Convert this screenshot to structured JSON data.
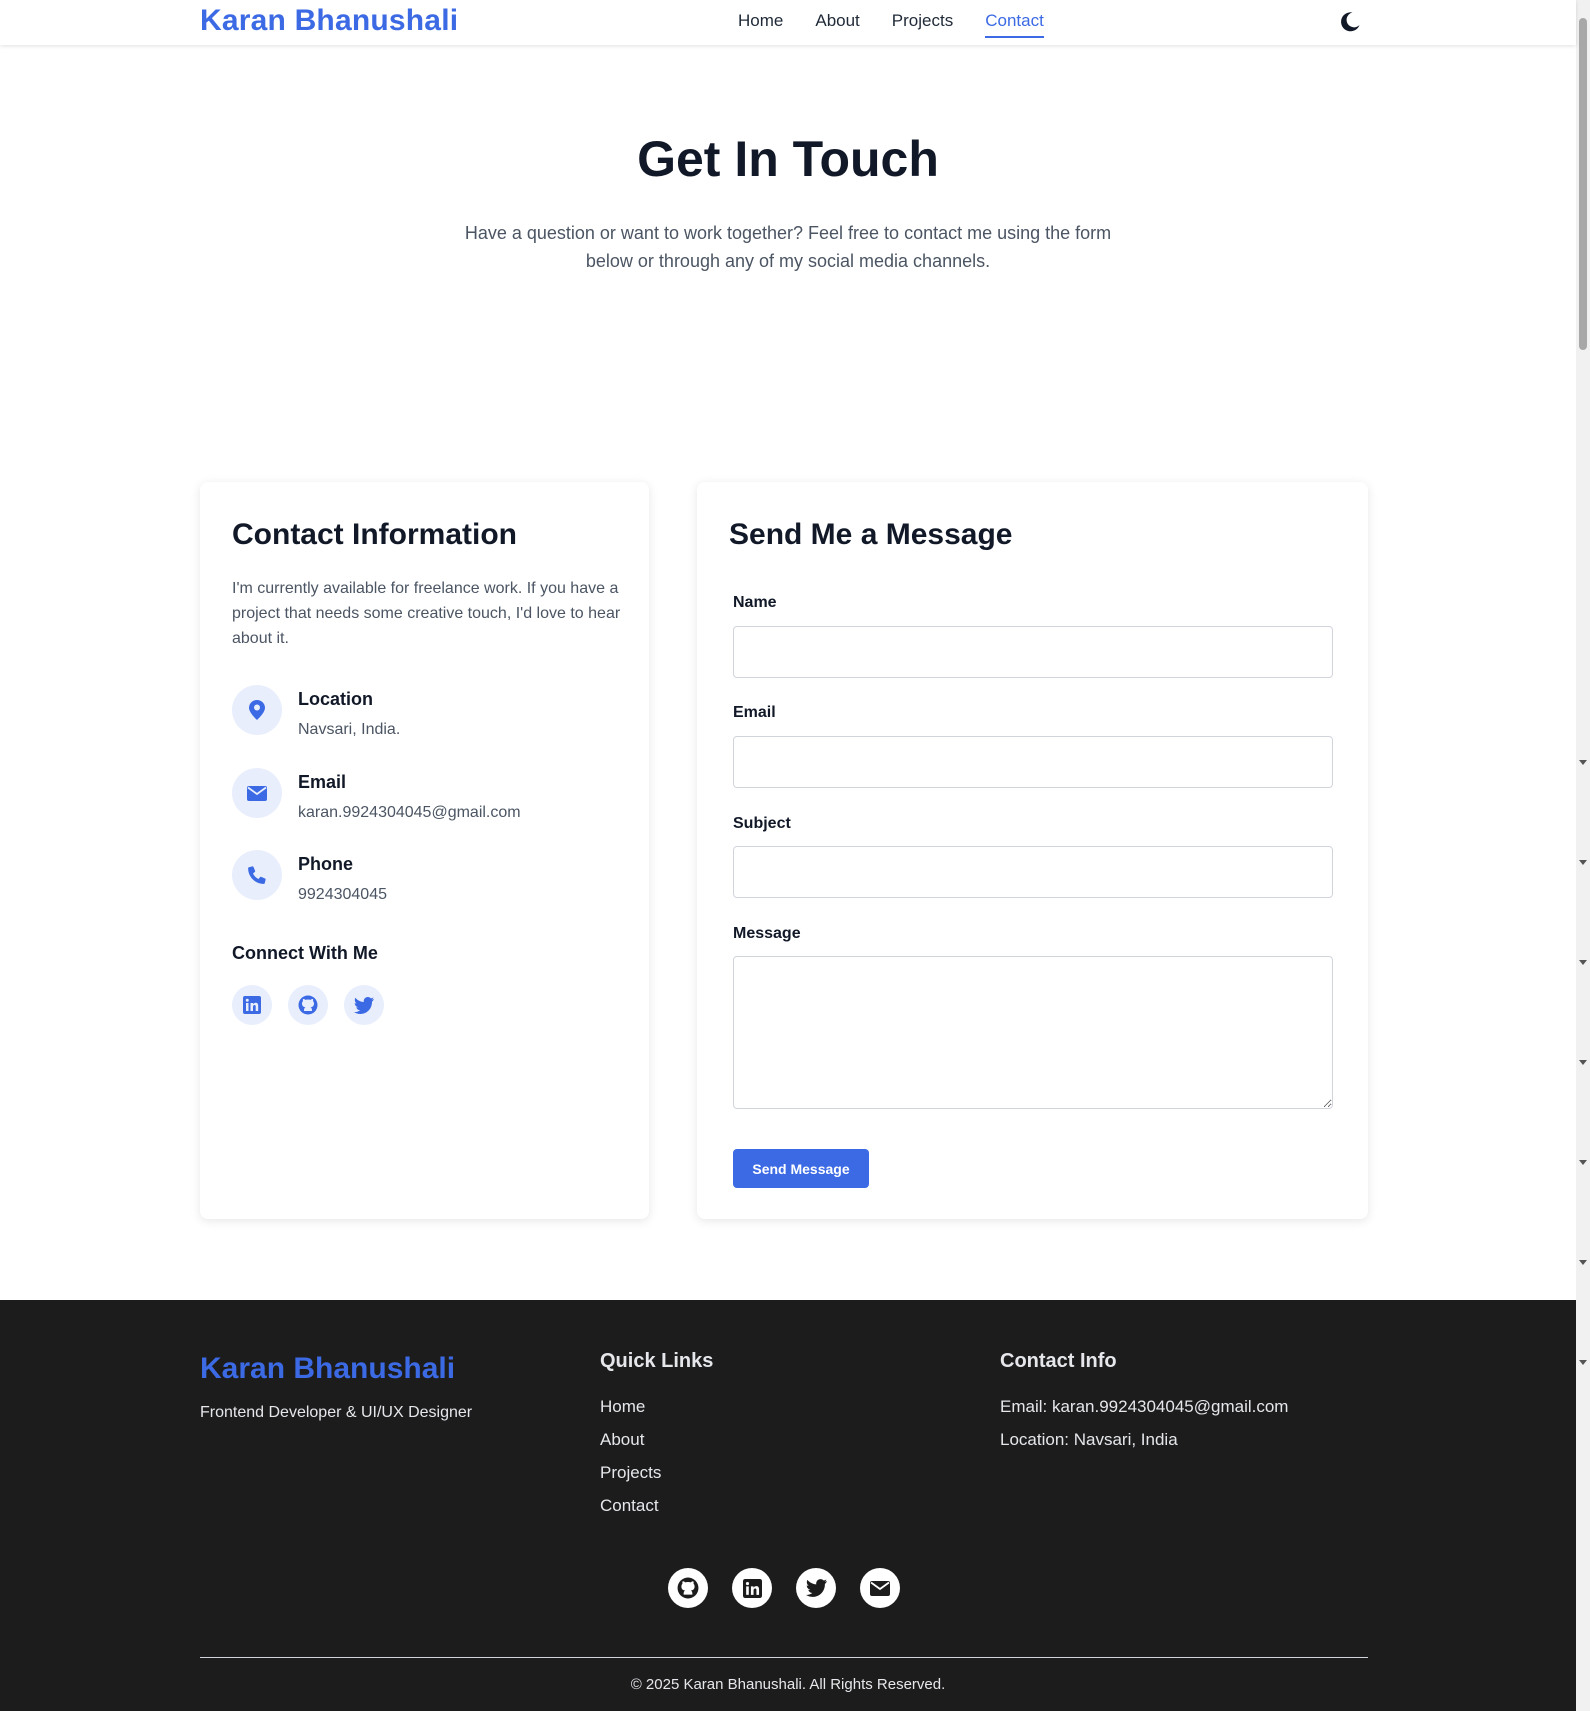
{
  "header": {
    "brand": "Karan Bhanushali",
    "nav": [
      {
        "label": "Home",
        "active": false
      },
      {
        "label": "About",
        "active": false
      },
      {
        "label": "Projects",
        "active": false
      },
      {
        "label": "Contact",
        "active": true
      }
    ],
    "theme_icon": "moon-icon"
  },
  "hero": {
    "title": "Get In Touch",
    "subtitle": "Have a question or want to work together? Feel free to contact me using the form below or through any of my social media channels."
  },
  "contact_info": {
    "title": "Contact Information",
    "description": "I'm currently available for freelance work. If you have a project that needs some creative touch, I'd love to hear about it.",
    "items": [
      {
        "icon": "location-pin-icon",
        "label": "Location",
        "value": "Navsari, India."
      },
      {
        "icon": "envelope-icon",
        "label": "Email",
        "value": "karan.9924304045@gmail.com"
      },
      {
        "icon": "phone-icon",
        "label": "Phone",
        "value": "9924304045"
      }
    ],
    "connect_title": "Connect With Me",
    "socials": [
      "linkedin-icon",
      "github-icon",
      "twitter-icon"
    ]
  },
  "form": {
    "title": "Send Me a Message",
    "fields": [
      {
        "label": "Name",
        "value": "",
        "placeholder": ""
      },
      {
        "label": "Email",
        "value": "",
        "placeholder": ""
      },
      {
        "label": "Subject",
        "value": "",
        "placeholder": ""
      },
      {
        "label": "Message",
        "value": "",
        "placeholder": ""
      }
    ],
    "submit_label": "Send Message"
  },
  "footer": {
    "brand": "Karan Bhanushali",
    "tagline": "Frontend Developer & UI/UX Designer",
    "quick_links_title": "Quick Links",
    "quick_links": [
      "Home",
      "About",
      "Projects",
      "Contact"
    ],
    "contact_title": "Contact Info",
    "contact_lines": [
      "Email: karan.9924304045@gmail.com",
      "Location: Navsari, India"
    ],
    "socials": [
      "github-icon",
      "linkedin-icon",
      "twitter-icon",
      "envelope-icon"
    ],
    "copyright": "© 2025 Karan Bhanushali. All Rights Reserved."
  },
  "colors": {
    "accent": "#3b6ae4",
    "footer_bg": "#1c1c1d",
    "icon_bg": "#e8eefc"
  }
}
